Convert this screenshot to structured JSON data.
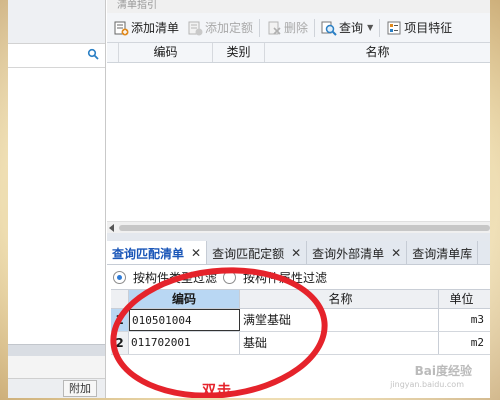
{
  "window": {
    "title_fragment": "清单指引"
  },
  "left_panel": {
    "attach_label": "附加"
  },
  "toolbar": {
    "add_list": "添加清单",
    "add_quota": "添加定额",
    "delete": "删除",
    "query": "查询",
    "item_feature": "项目特征"
  },
  "top_grid": {
    "columns": [
      "编码",
      "类别",
      "名称"
    ]
  },
  "tabs": [
    {
      "label": "查询匹配清单",
      "active": true
    },
    {
      "label": "查询匹配定额",
      "active": false
    },
    {
      "label": "查询外部清单",
      "active": false
    },
    {
      "label": "查询清单库",
      "active": false
    }
  ],
  "filters": {
    "by_type": "按构件类型过滤",
    "by_attr": "按构件属性过滤",
    "selected": "by_type"
  },
  "result_grid": {
    "columns": {
      "code": "编码",
      "name": "名称",
      "unit": "单位"
    },
    "rows": [
      {
        "index": "1",
        "code": "010501004",
        "name": "满堂基础",
        "unit": "m3"
      },
      {
        "index": "2",
        "code": "011702001",
        "name": "基础",
        "unit": "m2"
      }
    ]
  },
  "annotation": {
    "text": "双击",
    "color": "#e5232b"
  },
  "watermark": {
    "text": "Bai度经验",
    "sub": "jingyan.baidu.com"
  },
  "colors": {
    "accent": "#1a56b8",
    "selection": "#b9d7f3",
    "annotation": "#e5232b"
  }
}
